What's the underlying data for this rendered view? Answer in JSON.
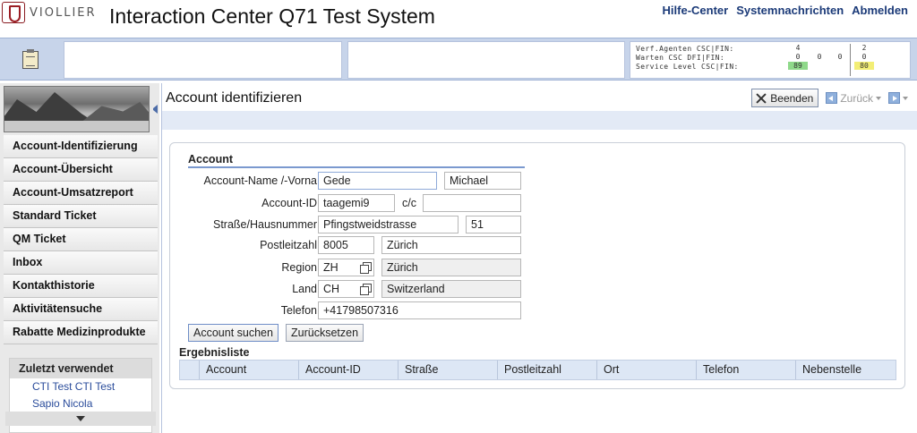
{
  "header": {
    "logo_text": "VIOLLIER",
    "title": "Interaction Center Q71 Test System",
    "links": [
      "Hilfe-Center",
      "Systemnachrichten",
      "Abmelden"
    ]
  },
  "stats": {
    "rows": [
      {
        "label": "Verf.Agenten CSC|FIN:",
        "values": [
          "4",
          "",
          "",
          "2"
        ]
      },
      {
        "label": "Warten CSC DFI|FIN:",
        "values": [
          "0",
          "0",
          "0",
          "0"
        ]
      },
      {
        "label": "Service Level CSC|FIN:",
        "values": [
          "89",
          "",
          "",
          "80"
        ]
      }
    ],
    "colors": {
      "green": "#8fd98a",
      "yellow": "#f3ee75"
    }
  },
  "sidebar": {
    "items": [
      {
        "label": "Account-Identifizierung"
      },
      {
        "label": "Account-Übersicht"
      },
      {
        "label": "Account-Umsatzreport"
      },
      {
        "label": "Standard Ticket"
      },
      {
        "label": "QM Ticket"
      },
      {
        "label": "Inbox"
      },
      {
        "label": "Kontakthistorie"
      },
      {
        "label": "Aktivitätensuche"
      },
      {
        "label": "Rabatte Medizinprodukte"
      }
    ],
    "recent_title": "Zuletzt verwendet",
    "recent_items": [
      "CTI Test CTI Test",
      "Sapio Nicola"
    ]
  },
  "main": {
    "page_title": "Account identifizieren",
    "toolbar": {
      "beenden": "Beenden",
      "zurueck": "Zurück"
    },
    "form": {
      "section_title": "Account",
      "labels": {
        "name": "Account-Name /-Vorna",
        "id": "Account-ID",
        "street": "Straße/Hausnummer",
        "zip": "Postleitzahl",
        "region": "Region",
        "land": "Land",
        "phone": "Telefon",
        "co": "c/c"
      },
      "values": {
        "last_name": "Gede",
        "first_name": "Michael",
        "account_id": "taagemi9",
        "co": "",
        "street": "Pfingstweidstrasse",
        "house_no": "51",
        "zip": "8005",
        "city": "Zürich",
        "region_code": "ZH",
        "region_name": "Zürich",
        "country_code": "CH",
        "country_name": "Switzerland",
        "phone": "+41798507316"
      },
      "buttons": {
        "search": "Account suchen",
        "reset": "Zurücksetzen"
      }
    },
    "results": {
      "title": "Ergebnisliste",
      "columns": [
        "Account",
        "Account-ID",
        "Straße",
        "Postleitzahl",
        "Ort",
        "Telefon",
        "Nebenstelle"
      ]
    }
  }
}
